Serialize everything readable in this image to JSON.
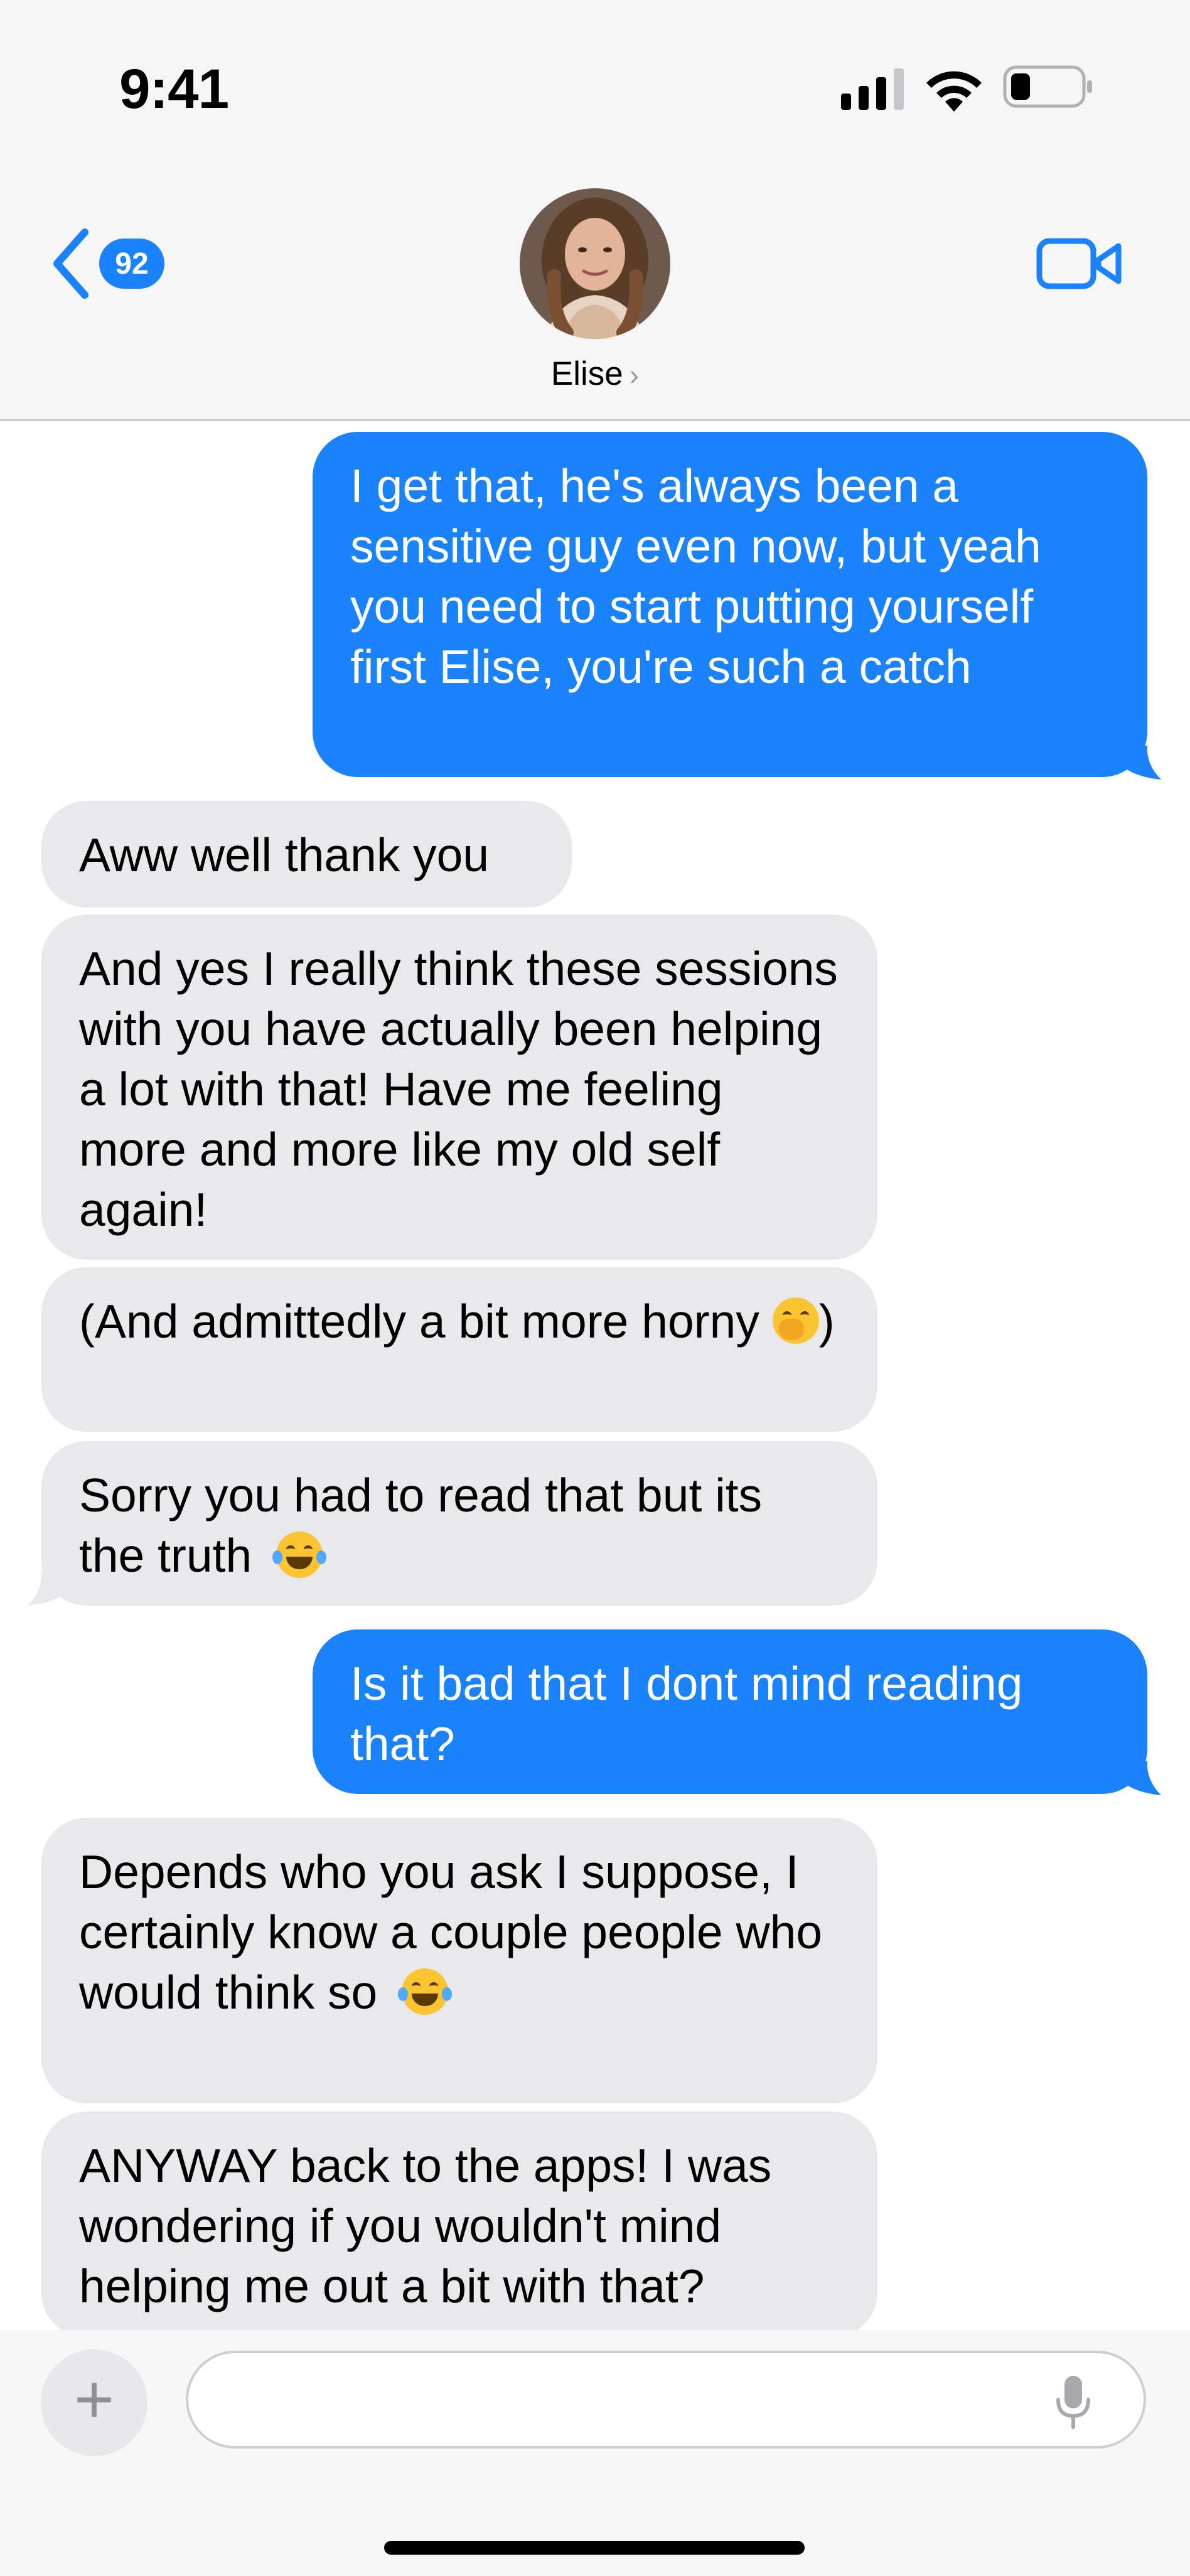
{
  "status_bar": {
    "time": "9:41"
  },
  "header": {
    "back_badge": "92",
    "contact_name": "Elise"
  },
  "messages": [
    {
      "direction": "sent",
      "text": "I get that, he's always been a sensitive guy even now, but yeah you need to start putting yourself first Elise, you're such a catch"
    },
    {
      "direction": "received",
      "text": "Aww well thank you"
    },
    {
      "direction": "received",
      "text": "And yes I really think these sessions with you have actually been helping a lot with that! Have me feeling more and more like my old self again!"
    },
    {
      "direction": "received",
      "text_before": "(And admittedly a bit more horny",
      "emoji": "face-with-hand-over-mouth",
      "text_after": ")"
    },
    {
      "direction": "received",
      "text": "Sorry you had to read that but its the truth",
      "emoji": "face-with-tears-of-joy"
    },
    {
      "direction": "sent",
      "text": "Is it bad that I dont mind reading that?"
    },
    {
      "direction": "received",
      "text": "Depends who you ask I suppose, I certainly know a couple people who would think so",
      "emoji": "face-with-tears-of-joy"
    },
    {
      "direction": "received",
      "text": "ANYWAY back to the apps! I was wondering if you wouldn't mind helping me out a bit with that?"
    }
  ],
  "composer": {
    "placeholder": "",
    "plus_label": "+"
  },
  "colors": {
    "sent_bubble": "#1a82fb",
    "received_bubble": "#e9e9eb",
    "accent": "#1a82fb"
  },
  "icons": [
    "signal-icon",
    "wifi-icon",
    "battery-icon",
    "back-chevron-icon",
    "video-call-icon",
    "microphone-icon"
  ]
}
